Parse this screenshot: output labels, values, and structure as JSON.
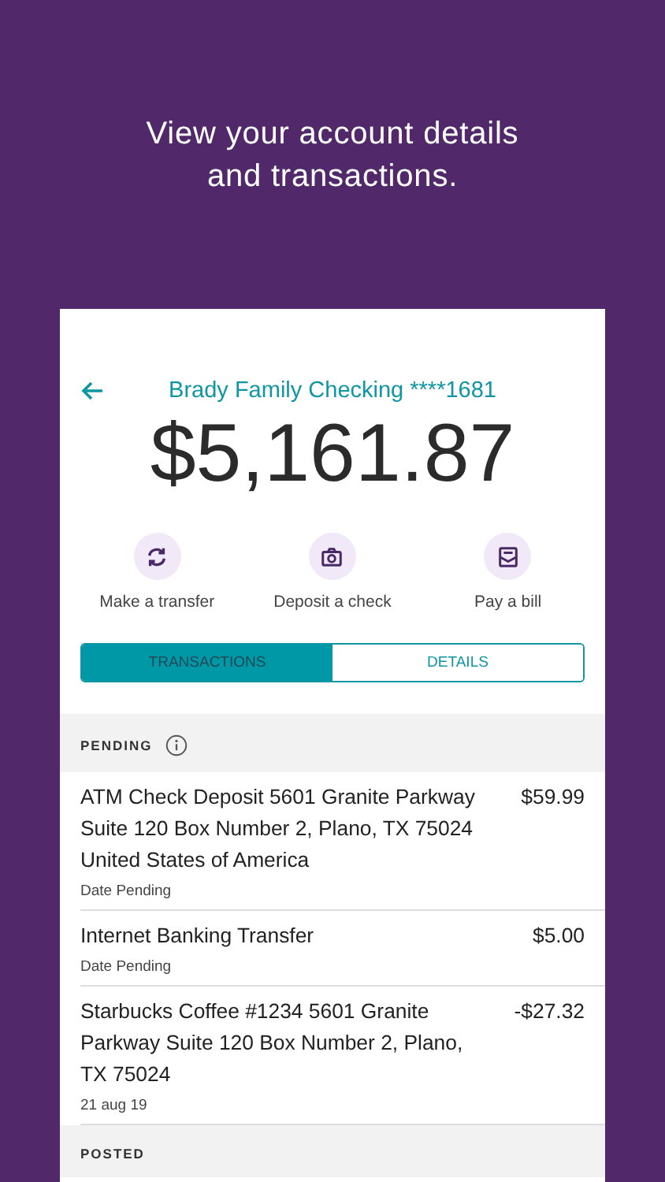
{
  "caption": "View your account details and transactions.",
  "account": {
    "name": "Brady Family Checking ****1681",
    "balance": "$5,161.87"
  },
  "actions": [
    {
      "kind": "transfer",
      "label": "Make a transfer"
    },
    {
      "kind": "deposit",
      "label": "Deposit a check"
    },
    {
      "kind": "bill",
      "label": "Pay a bill"
    }
  ],
  "tabs": [
    {
      "label": "TRANSACTIONS",
      "selected": true
    },
    {
      "label": "DETAILS",
      "selected": false
    }
  ],
  "sections": [
    {
      "title": "PENDING",
      "info": true,
      "transactions": [
        {
          "description": "ATM Check Deposit 5601 Granite Parkway Suite 120 Box Number 2, Plano, TX 75024 United States of America",
          "amount": "$59.99",
          "date": "Date Pending"
        },
        {
          "description": "Internet Banking Transfer",
          "amount": "$5.00",
          "date": "Date Pending"
        },
        {
          "description": "Starbucks Coffee #1234 5601 Granite Parkway Suite 120 Box Number 2, Plano, TX 75024",
          "amount": "-$27.32",
          "date": "21 aug 19"
        }
      ]
    },
    {
      "title": "POSTED",
      "info": false
    }
  ]
}
